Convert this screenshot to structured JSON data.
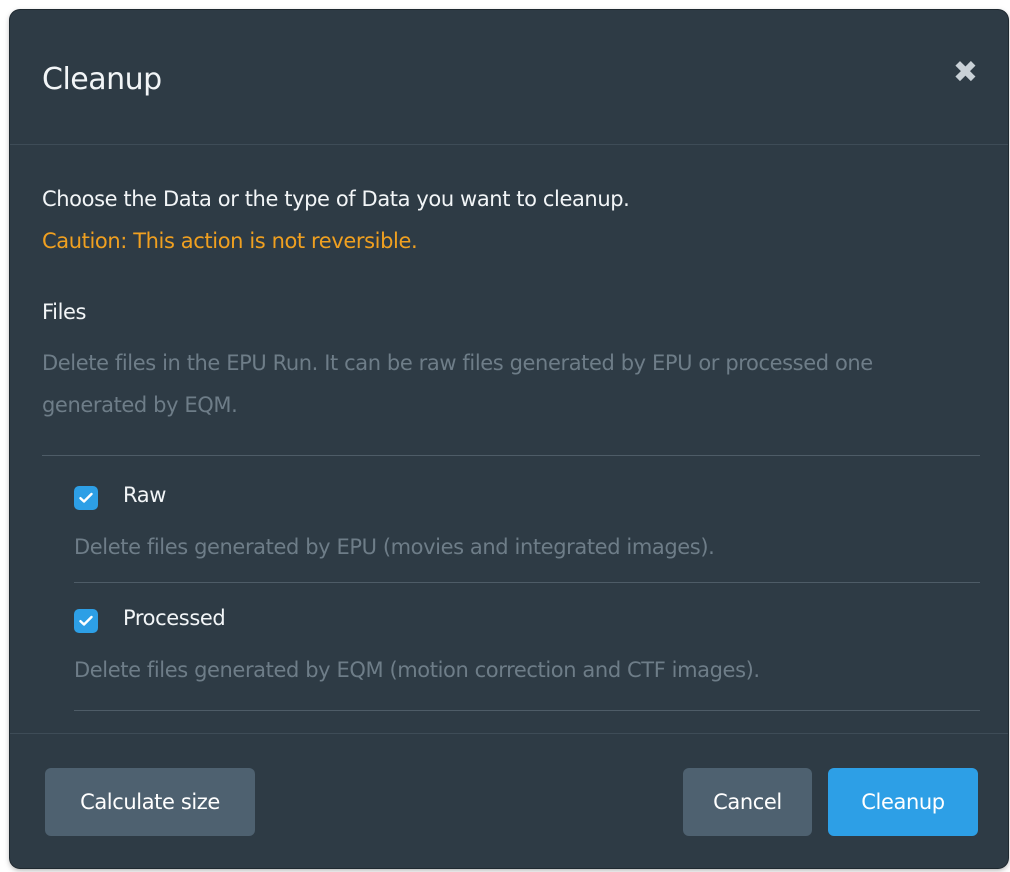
{
  "dialog": {
    "title": "Cleanup",
    "close_symbol": "✖"
  },
  "body": {
    "intro": "Choose the Data or the type of Data you want to cleanup.",
    "caution": "Caution: This action is not reversible.",
    "section": {
      "title": "Files",
      "description": "Delete files in the EPU Run. It can be raw files generated by EPU or processed one generated by EQM."
    },
    "options": [
      {
        "label": "Raw",
        "checked": true,
        "description": "Delete files generated by EPU (movies and integrated images)."
      },
      {
        "label": "Processed",
        "checked": true,
        "description": "Delete files generated by EQM (motion correction and CTF images)."
      }
    ]
  },
  "footer": {
    "calculate_label": "Calculate size",
    "cancel_label": "Cancel",
    "confirm_label": "Cleanup"
  },
  "colors": {
    "background": "#2e3b45",
    "accent": "#2d9fe6",
    "caution": "#f0a020",
    "muted_text": "#6e7d88",
    "secondary_button": "#4e6170"
  }
}
